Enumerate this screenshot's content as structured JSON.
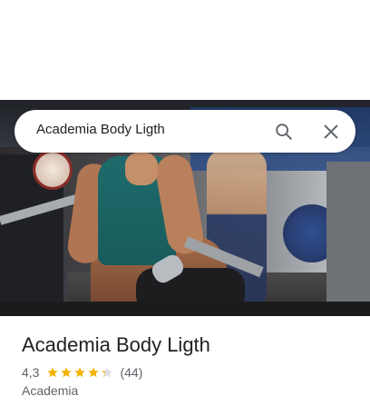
{
  "search": {
    "query": "Academia Body Ligth",
    "search_icon": "search-icon",
    "close_icon": "close-icon"
  },
  "place": {
    "name": "Academia Body Ligth",
    "rating": "4,3",
    "rating_value": 4.3,
    "rating_max": 5,
    "review_count": "(44)",
    "category": "Academia"
  },
  "colors": {
    "star": "#f4b400",
    "star_empty": "#dadce0",
    "text_primary": "#202124",
    "text_secondary": "#5f6368"
  }
}
